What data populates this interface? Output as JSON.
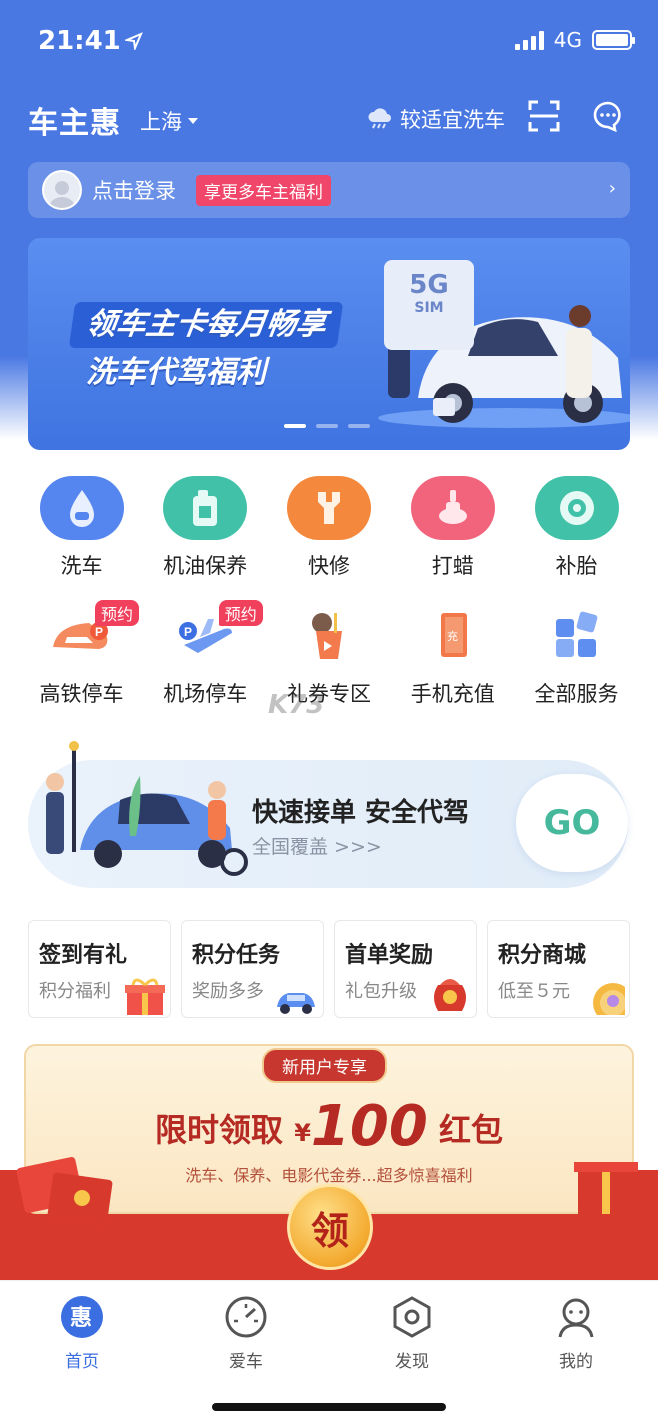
{
  "status_bar": {
    "time": "21:41",
    "network": "4G"
  },
  "header": {
    "brand": "车主惠",
    "city": "上海",
    "weather_text": "较适宜洗车",
    "weather_icon": "rain-cloud-icon",
    "scan_icon": "scan-icon",
    "message_icon": "chat-icon"
  },
  "login": {
    "text": "点击登录",
    "perk": "享更多车主福利"
  },
  "banner": {
    "line1": "领车主卡每月畅享",
    "line2": "洗车代驾福利",
    "sim_5g": "5G",
    "sim_label": "SIM",
    "page_count": 3,
    "active_page": 1
  },
  "services_row1": [
    {
      "label": "洗车",
      "icon": "car-wash-drop-icon",
      "color": "#4f7ff0"
    },
    {
      "label": "机油保养",
      "icon": "oil-can-icon",
      "color": "#3fc0a8"
    },
    {
      "label": "快修",
      "icon": "wrench-icon",
      "color": "#f4883c"
    },
    {
      "label": "打蜡",
      "icon": "wax-bottle-icon",
      "color": "#f2617b"
    },
    {
      "label": "补胎",
      "icon": "tire-icon",
      "color": "#3fc0a8"
    }
  ],
  "services_row2": [
    {
      "label": "高铁停车",
      "icon": "train-parking-icon",
      "tag": "预约"
    },
    {
      "label": "机场停车",
      "icon": "airport-parking-icon",
      "tag": "预约"
    },
    {
      "label": "礼券专区",
      "icon": "coupon-cup-icon",
      "tag": ""
    },
    {
      "label": "手机充值",
      "icon": "phone-recharge-icon",
      "tag": ""
    },
    {
      "label": "全部服务",
      "icon": "all-services-cubes-icon",
      "tag": ""
    }
  ],
  "designated_driver": {
    "title": "快速接单 安全代驾",
    "subtitle": "全国覆盖 >>>",
    "go_label": "GO"
  },
  "reward_cards": [
    {
      "title": "签到有礼",
      "subtitle": "积分福利",
      "icon": "gift-box-icon"
    },
    {
      "title": "积分任务",
      "subtitle": "奖励多多",
      "icon": "small-car-icon"
    },
    {
      "title": "首单奖励",
      "subtitle": "礼包升级",
      "icon": "lucky-bag-icon"
    },
    {
      "title": "积分商城",
      "subtitle": "低至５元",
      "icon": "coin-icon"
    }
  ],
  "promo": {
    "tag": "新用户专享",
    "headline_pre": "限时领取",
    "currency": "¥",
    "amount": "100",
    "headline_post": "红包",
    "subtitle": "洗车、保养、电影代金券...超多惊喜福利",
    "claim_label": "领"
  },
  "tabs": [
    {
      "label": "首页",
      "icon": "home-hui-icon",
      "active": true
    },
    {
      "label": "爱车",
      "icon": "speedometer-icon",
      "active": false
    },
    {
      "label": "发现",
      "icon": "hexagon-discover-icon",
      "active": false
    },
    {
      "label": "我的",
      "icon": "profile-icon",
      "active": false
    }
  ],
  "watermark": "K73"
}
